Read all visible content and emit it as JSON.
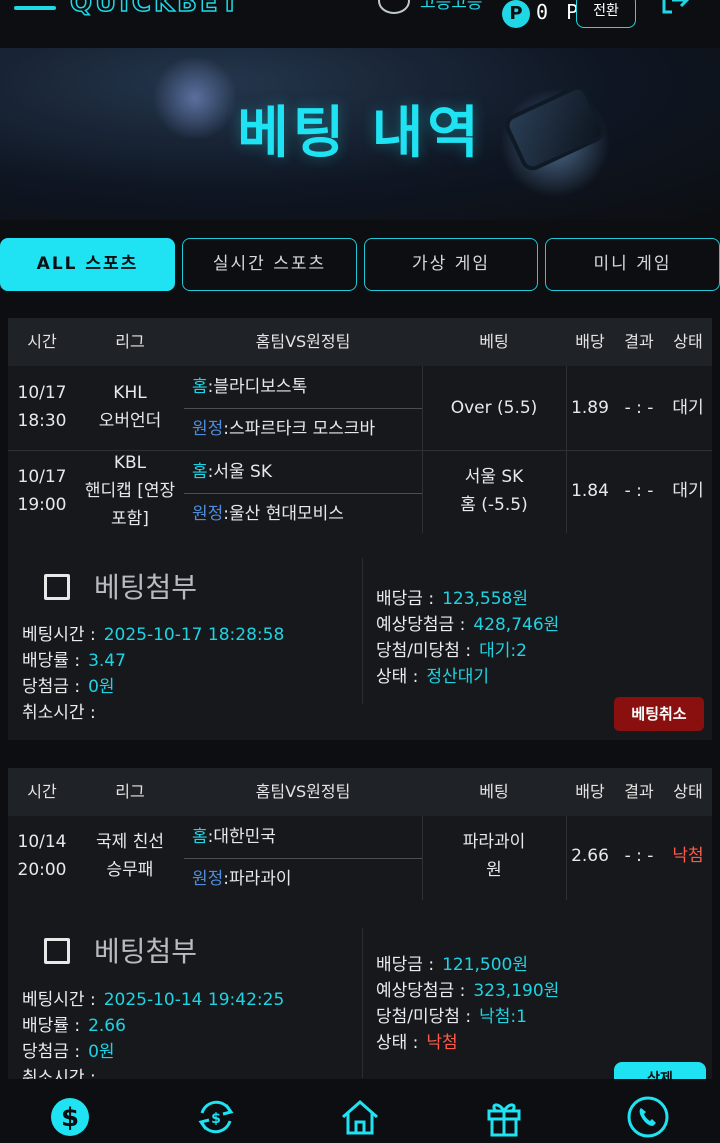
{
  "header": {
    "logo": "QUICKBET",
    "user_name": "고승고승",
    "point_symbol": "P",
    "point_value": "0 P",
    "switch_label": "전환"
  },
  "banner": {
    "title": "베팅 내역"
  },
  "tabs": [
    {
      "label": "ALL 스포츠",
      "active": true
    },
    {
      "label": "실시간 스포츠",
      "active": false
    },
    {
      "label": "가상 게임",
      "active": false
    },
    {
      "label": "미니 게임",
      "active": false
    }
  ],
  "table_headers": [
    "시간",
    "리그",
    "홈팀VS원정팀",
    "베팅",
    "배당",
    "결과",
    "상태"
  ],
  "team_labels": {
    "home": "홈",
    "away": "원정"
  },
  "bet_cards": [
    {
      "rows": [
        {
          "date": "10/17",
          "time": "18:30",
          "league_lines": [
            "KHL",
            "오버언더"
          ],
          "home": ":블라디보스톡",
          "away": ":스파르타크 모스크바",
          "bet_lines": [
            "Over  (5.5)"
          ],
          "odds": "1.89",
          "result": "- : -",
          "status": "대기"
        },
        {
          "date": "10/17",
          "time": "19:00",
          "league_lines": [
            "KBL",
            "핸디캡 [연장",
            "포함]"
          ],
          "home": ":서울 SK",
          "away": ":울산 현대모비스",
          "bet_lines": [
            "서울 SK",
            "홈  (-5.5)"
          ],
          "odds": "1.84",
          "result": "- : -",
          "status": "대기"
        }
      ],
      "attach_label": "베팅첨부",
      "left_info": [
        {
          "label": "베팅시간 :",
          "value": "2025-10-17 18:28:58"
        },
        {
          "label": "배당률 :",
          "value": "3.47"
        },
        {
          "label": "당첨금 :",
          "value": "0원"
        },
        {
          "label": "취소시간 :",
          "value": ""
        }
      ],
      "right_info": [
        {
          "label": "배당금 :",
          "value": "123,558원"
        },
        {
          "label": "예상당첨금 :",
          "value": "428,746원"
        },
        {
          "label": "당첨/미당첨 :",
          "value": "대기:2"
        },
        {
          "label": "상태 :",
          "value": "정산대기"
        }
      ],
      "action_label": "베팅취소"
    },
    {
      "rows": [
        {
          "date": "10/14",
          "time": "20:00",
          "league_lines": [
            "국제 친선",
            "승무패"
          ],
          "home": ":대한민국",
          "away": ":파라과이",
          "bet_lines": [
            "파라과이",
            "원"
          ],
          "odds": "2.66",
          "result": "- : -",
          "status": "낙첨"
        }
      ],
      "attach_label": "베팅첨부",
      "left_info": [
        {
          "label": "베팅시간 :",
          "value": "2025-10-14 19:42:25"
        },
        {
          "label": "배당률 :",
          "value": "2.66"
        },
        {
          "label": "당첨금 :",
          "value": "0원"
        },
        {
          "label": "취소시간 :",
          "value": ""
        }
      ],
      "right_info": [
        {
          "label": "배당금 :",
          "value": "121,500원"
        },
        {
          "label": "예상당첨금 :",
          "value": "323,190원"
        },
        {
          "label": "당첨/미당첨 :",
          "value": "낙첨:1"
        },
        {
          "label": "상태 :",
          "value": "낙첨"
        }
      ],
      "action_label": "삭제"
    }
  ],
  "bottom_nav": [
    "dollar-icon",
    "exchange-icon",
    "home-icon",
    "gift-icon",
    "phone-icon"
  ],
  "colors": {
    "accent": "#1fe3f2",
    "lose": "#ff5a4a",
    "cancel": "#8a1010",
    "away_label": "#4f8cdc"
  }
}
